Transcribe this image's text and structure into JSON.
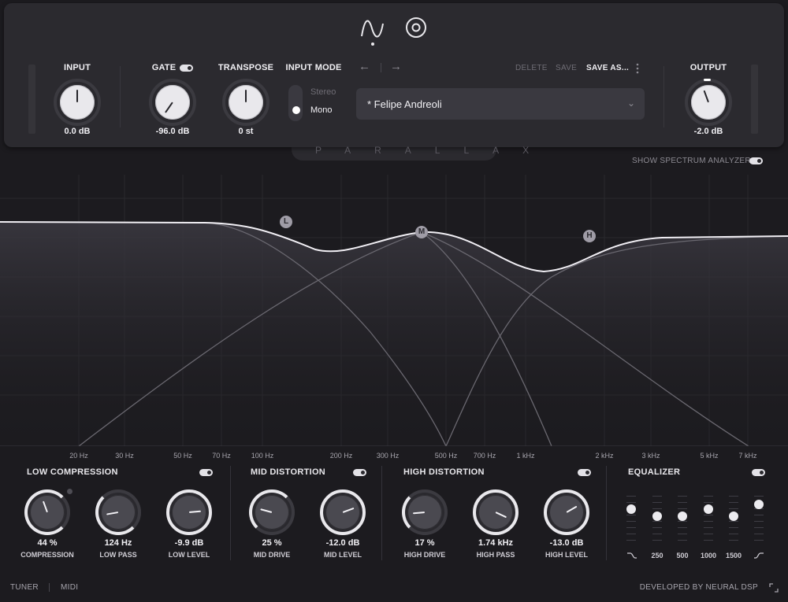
{
  "header": {
    "brand": "PARALLAX",
    "input": {
      "label": "INPUT",
      "value": "0.0 dB"
    },
    "gate": {
      "label": "GATE",
      "value": "-96.0 dB"
    },
    "transpose": {
      "label": "TRANSPOSE",
      "value": "0 st"
    },
    "input_mode": {
      "label": "INPUT MODE",
      "options": [
        "Stereo",
        "Mono"
      ],
      "selected": "Mono"
    },
    "output": {
      "label": "OUTPUT",
      "value": "-2.0 dB"
    },
    "preset": {
      "name": "* Felipe Andreoli"
    },
    "menu": {
      "delete": "DELETE",
      "save": "SAVE",
      "save_as": "SAVE AS..."
    },
    "nav": {
      "back": "←",
      "forward": "→"
    }
  },
  "graph": {
    "show_spectrum_label": "SHOW SPECTRUM ANALYZER",
    "nodes": [
      {
        "id": "L"
      },
      {
        "id": "M"
      },
      {
        "id": "H"
      }
    ],
    "freq_labels": [
      "20 Hz",
      "30 Hz",
      "50 Hz",
      "70 Hz",
      "100 Hz",
      "200 Hz",
      "300 Hz",
      "500 Hz",
      "700 Hz",
      "1 kHz",
      "2 kHz",
      "3 kHz",
      "5 kHz",
      "7 kHz"
    ]
  },
  "sections": {
    "low": {
      "title": "LOW COMPRESSION",
      "knobs": [
        {
          "value": "44 %",
          "label": "COMPRESSION"
        },
        {
          "value": "124 Hz",
          "label": "LOW PASS"
        },
        {
          "value": "-9.9 dB",
          "label": "LOW LEVEL"
        }
      ]
    },
    "mid": {
      "title": "MID DISTORTION",
      "knobs": [
        {
          "value": "25 %",
          "label": "MID DRIVE"
        },
        {
          "value": "-12.0 dB",
          "label": "MID LEVEL"
        }
      ]
    },
    "high": {
      "title": "HIGH DISTORTION",
      "knobs": [
        {
          "value": "17 %",
          "label": "HIGH DRIVE"
        },
        {
          "value": "1.74 kHz",
          "label": "HIGH PASS"
        },
        {
          "value": "-13.0 dB",
          "label": "HIGH LEVEL"
        }
      ]
    },
    "eq": {
      "title": "EQUALIZER",
      "bands": [
        "250",
        "500",
        "1000",
        "1500"
      ]
    }
  },
  "footer": {
    "tuner": "TUNER",
    "midi": "MIDI",
    "credit": "DEVELOPED BY NEURAL DSP"
  },
  "colors": {
    "background": "#1c1b1f",
    "panel": "#2b2a2f",
    "curve": "#f1eff4",
    "accent": "#ffffff"
  }
}
